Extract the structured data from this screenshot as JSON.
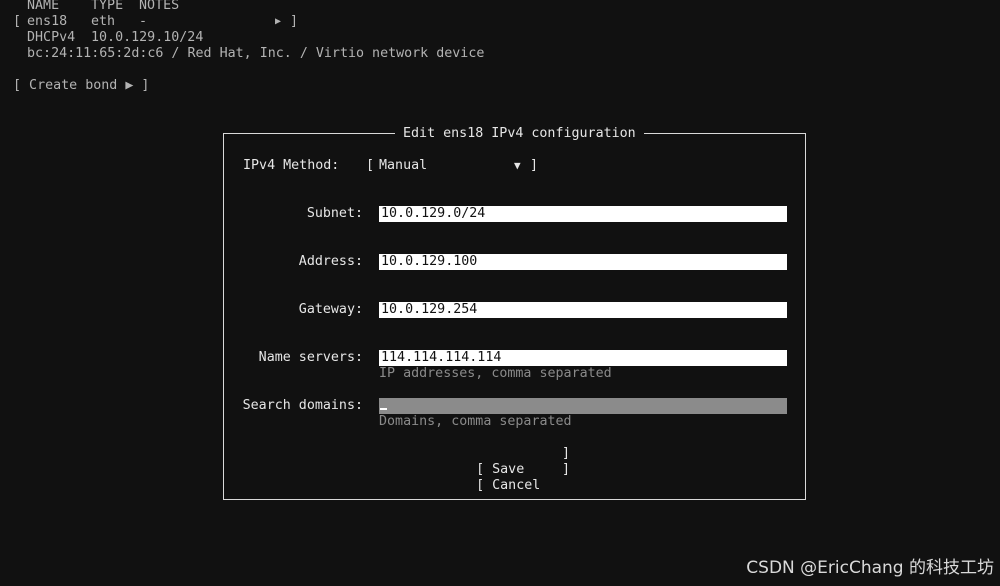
{
  "interfaces": {
    "headers": [
      "NAME",
      "TYPE",
      "NOTES"
    ],
    "rows": [
      {
        "name": "ens18",
        "type": "eth",
        "notes": "-",
        "arrow": "▶",
        "dhcp_label": "DHCPv4",
        "dhcp_value": "10.0.129.10/24",
        "device_info": "bc:24:11:65:2d:c6 / Red Hat, Inc. / Virtio network device"
      }
    ],
    "create_bond": "[ Create bond ▶ ]"
  },
  "dialog": {
    "title": "Edit ens18 IPv4 configuration",
    "method_label": "IPv4 Method:",
    "method_value": "Manual",
    "method_arrow": "▼",
    "fields": {
      "subnet": {
        "label": "Subnet:",
        "value": "10.0.129.0/24"
      },
      "address": {
        "label": "Address:",
        "value": "10.0.129.100"
      },
      "gateway": {
        "label": "Gateway:",
        "value": "10.0.129.254"
      },
      "name_servers": {
        "label": "Name servers:",
        "value": "114.114.114.114",
        "hint": "IP addresses, comma separated"
      },
      "search_domains": {
        "label": "Search domains:",
        "value": "",
        "hint": "Domains, comma separated"
      }
    },
    "buttons": {
      "save": "Save",
      "cancel": "Cancel"
    }
  },
  "watermark": "CSDN @EricChang 的科技工坊",
  "colors": {
    "background": "#111111",
    "field_bg": "#ffffff",
    "focused_field_bg": "#8b8b8b",
    "text": "#e6e6e6"
  }
}
